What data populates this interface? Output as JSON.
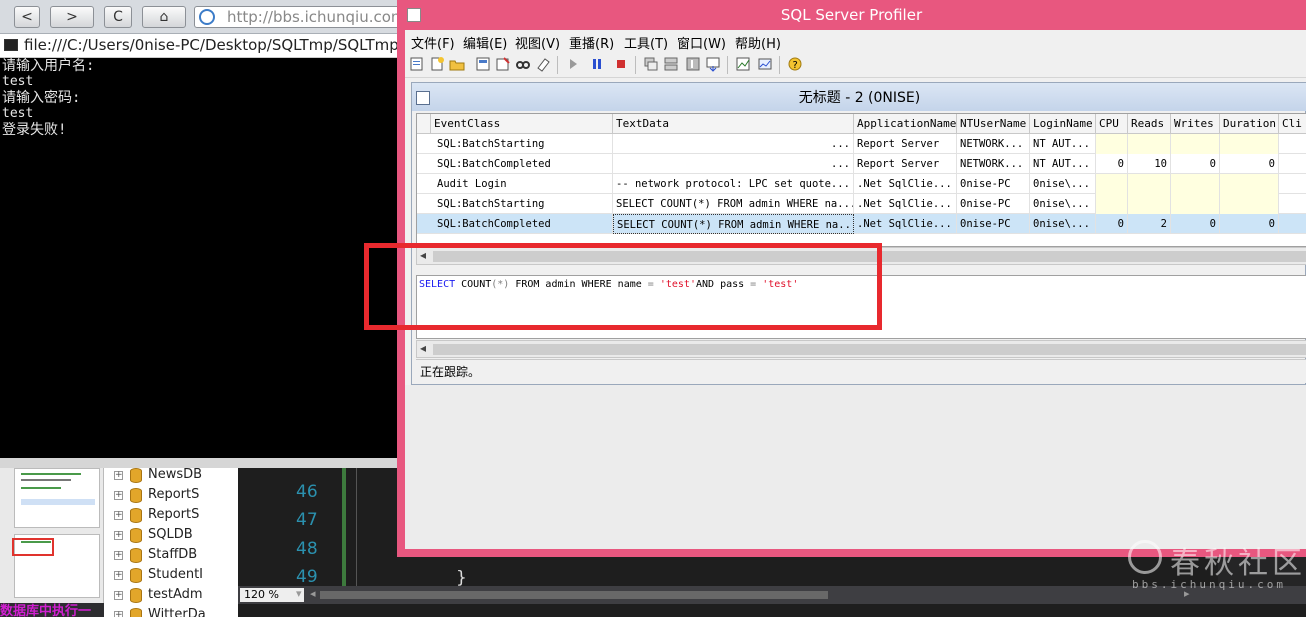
{
  "browser": {
    "url": "http://bbs.ichunqiu.com",
    "back": "<",
    "forward": ">",
    "reload": "C",
    "home": "⌂"
  },
  "console": {
    "title": "file:///C:/Users/0nise-PC/Desktop/SQLTmp/SQLTmp",
    "lines": [
      "请输入用户名:",
      "test",
      "请输入密码:",
      "test",
      "登录失败!"
    ]
  },
  "thumbnails": {
    "bottom_text": "数据库中执行一"
  },
  "db_tree": {
    "items": [
      "NewsDB",
      "ReportS",
      "ReportS",
      "SQLDB",
      "StaffDB",
      "StudentI",
      "testAdm",
      "WitterDa"
    ]
  },
  "editor": {
    "line_numbers": [
      "46",
      "47",
      "48",
      "49"
    ],
    "brace": "}",
    "zoom": "120 %"
  },
  "profiler": {
    "title": "SQL Server Profiler",
    "menu": [
      "文件(F)",
      "编辑(E)",
      "视图(V)",
      "重播(R)",
      "工具(T)",
      "窗口(W)",
      "帮助(H)"
    ],
    "trace_title": "无标题 - 2 (0NISE)",
    "columns": [
      "EventClass",
      "TextData",
      "ApplicationName",
      "NTUserName",
      "LoginName",
      "CPU",
      "Reads",
      "Writes",
      "Duration",
      "Cli"
    ],
    "rows": [
      {
        "event": "SQL:BatchStarting",
        "text": "...",
        "app": "Report Server",
        "nt": "NETWORK...",
        "login": "NT AUT...",
        "cpu": "",
        "reads": "",
        "writes": "",
        "duration": "",
        "selected": false
      },
      {
        "event": "SQL:BatchCompleted",
        "text": "...",
        "app": "Report Server",
        "nt": "NETWORK...",
        "login": "NT AUT...",
        "cpu": "0",
        "reads": "10",
        "writes": "0",
        "duration": "0",
        "selected": false
      },
      {
        "event": "Audit Login",
        "text": "-- network protocol: LPC  set quote...",
        "app": ".Net SqlClie...",
        "nt": "0nise-PC",
        "login": "0nise\\...",
        "cpu": "",
        "reads": "",
        "writes": "",
        "duration": "",
        "selected": false
      },
      {
        "event": "SQL:BatchStarting",
        "text": "SELECT COUNT(*) FROM admin WHERE na...",
        "app": ".Net SqlClie...",
        "nt": "0nise-PC",
        "login": "0nise\\...",
        "cpu": "",
        "reads": "",
        "writes": "",
        "duration": "",
        "selected": false
      },
      {
        "event": "SQL:BatchCompleted",
        "text": "SELECT COUNT(*) FROM admin WHERE na...",
        "app": ".Net SqlClie...",
        "nt": "0nise-PC",
        "login": "0nise\\...",
        "cpu": "0",
        "reads": "2",
        "writes": "0",
        "duration": "0",
        "selected": true
      }
    ],
    "sql": {
      "kw1": "SELECT",
      "p1": " COUNT",
      "p2": "(*)",
      "p3": " FROM admin WHERE name ",
      "eq1": "=",
      "s1": " 'test'",
      "p4": "AND pass ",
      "eq2": "=",
      "s2": " 'test'"
    },
    "status": "正在跟踪。"
  },
  "watermark": {
    "text": "春秋社区",
    "sub": "bbs.ichunqiu.com"
  },
  "colors": {
    "profiler_frame": "#e8577f",
    "highlight_red": "#e8292e",
    "sql_keyword": "#1a1af0",
    "sql_string": "#e0102a",
    "selected_row": "#cce4f7"
  }
}
